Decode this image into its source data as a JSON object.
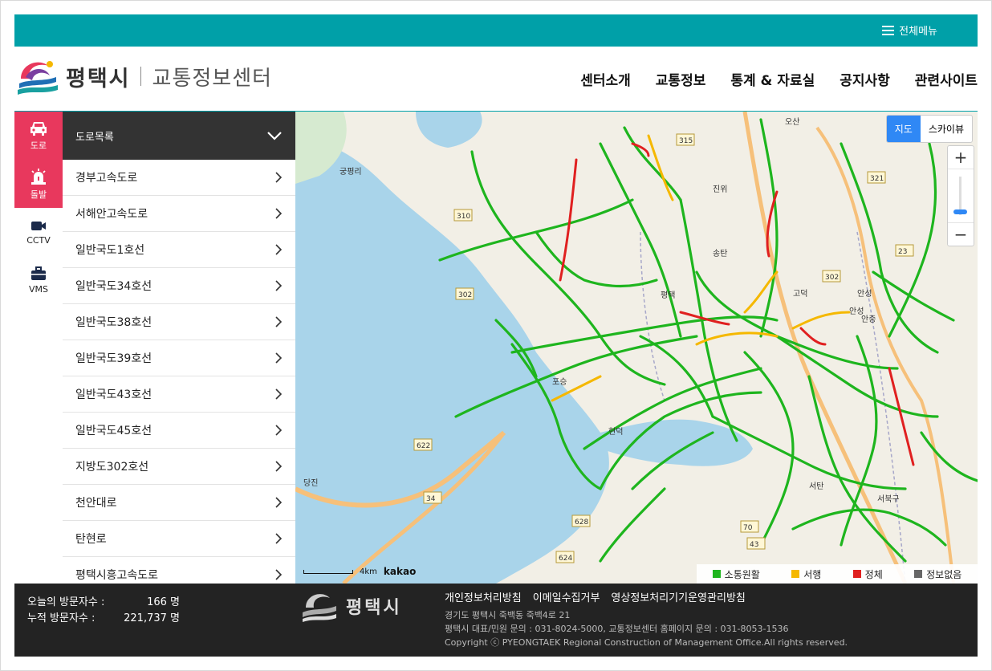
{
  "topbar": {
    "menu_label": "전체메뉴"
  },
  "header": {
    "city": "평택시",
    "center_name": "교통정보센터",
    "nav": [
      "센터소개",
      "교통정보",
      "통계 & 자료실",
      "공지사항",
      "관련사이트"
    ]
  },
  "sidebar": {
    "tabs": [
      {
        "label": "도로",
        "icon": "car-icon",
        "active": true
      },
      {
        "label": "돌발",
        "icon": "siren-icon",
        "active": true
      },
      {
        "label": "CCTV",
        "icon": "camera-icon",
        "active": false
      },
      {
        "label": "VMS",
        "icon": "briefcase-icon",
        "active": false
      }
    ]
  },
  "road_panel": {
    "title": "도로목록",
    "roads": [
      "경부고속도로",
      "서해안고속도로",
      "일반국도1호선",
      "일반국도34호선",
      "일반국도38호선",
      "일반국도39호선",
      "일반국도43호선",
      "일반국도45호선",
      "지방도302호선",
      "천안대로",
      "탄현로",
      "평택시흥고속도로"
    ]
  },
  "map": {
    "mode_buttons": [
      "지도",
      "스카이뷰"
    ],
    "active_mode": "지도",
    "scale_label": "4km",
    "provider": "kakao",
    "place_labels": [
      "궁평리",
      "오산",
      "평택",
      "포승",
      "현덕",
      "당진",
      "송탄",
      "안성",
      "서탄",
      "서북구",
      "안중",
      "고덕",
      "진위",
      "안성"
    ],
    "road_numbers": [
      "315",
      "310",
      "302",
      "321",
      "23",
      "622",
      "34",
      "628",
      "624",
      "70",
      "43",
      "302"
    ],
    "legend": [
      {
        "label": "소통원활",
        "color": "#1eb51e"
      },
      {
        "label": "서행",
        "color": "#f5b800"
      },
      {
        "label": "정체",
        "color": "#e02020"
      },
      {
        "label": "정보없음",
        "color": "#666666"
      }
    ]
  },
  "footer": {
    "visitors_today_label": "오늘의 방문자수 :",
    "visitors_today": "166 명",
    "visitors_total_label": "누적 방문자수  :",
    "visitors_total": "221,737 명",
    "city": "평택시",
    "links": [
      "개인정보처리방침",
      "이메일수집거부",
      "영상정보처리기기운영관리방침"
    ],
    "address": "경기도 평택시 죽백동 죽백4로 21",
    "contact": "평택시 대표/민원 문의 : 031-8024-5000, 교통정보센터 홈페이지 문의 : 031-8053-1536",
    "copyright": "Copyright ⓒ PYEONGTAEK Regional Construction of Management Office.All rights reserved."
  }
}
